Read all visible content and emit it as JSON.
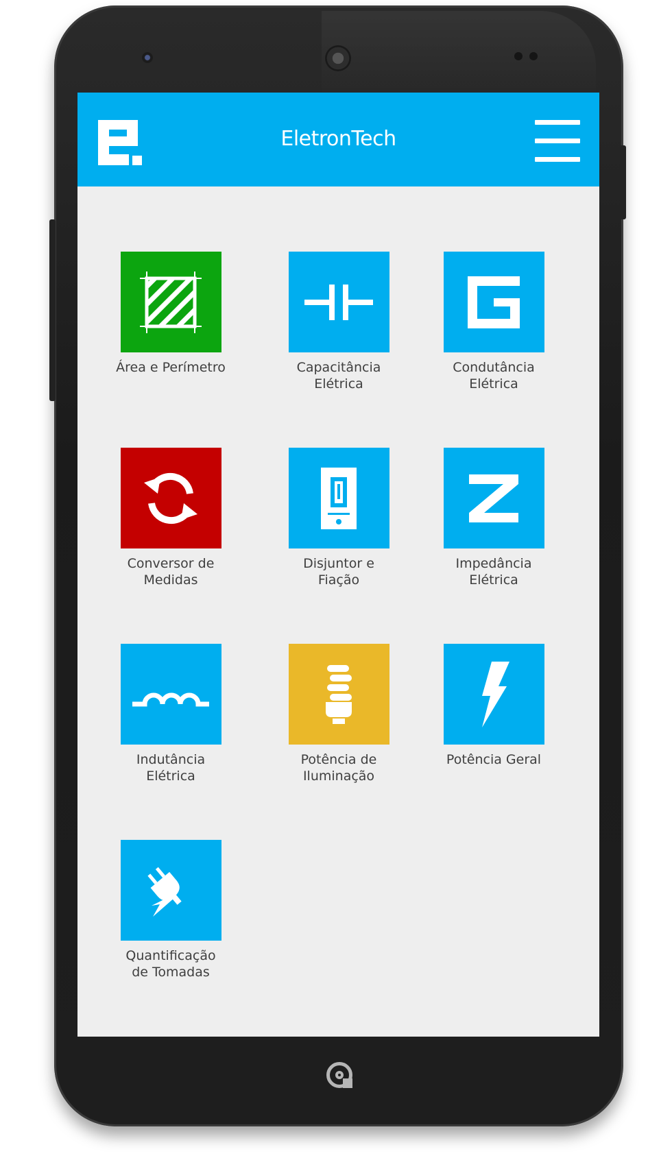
{
  "app": {
    "title": "EletronTech"
  },
  "colors": {
    "appbar": "#00aeef",
    "blue": "#00aeef",
    "green": "#0ca50f",
    "red": "#c40000",
    "yellow": "#eab829"
  },
  "tiles": [
    {
      "label": "Área e Perímetro",
      "icon": "area-hatch-icon",
      "color": "#0ca50f"
    },
    {
      "label": "Capacitância\nElétrica",
      "icon": "capacitor-icon",
      "color": "#00aeef"
    },
    {
      "label": "Condutância\nElétrica",
      "icon": "conductance-g-icon",
      "color": "#00aeef"
    },
    {
      "label": "Conversor de\nMedidas",
      "icon": "refresh-arrows-icon",
      "color": "#c40000"
    },
    {
      "label": "Disjuntor e\nFiação",
      "icon": "breaker-switch-icon",
      "color": "#00aeef"
    },
    {
      "label": "Impedância\nElétrica",
      "icon": "impedance-z-icon",
      "color": "#00aeef"
    },
    {
      "label": "Indutância\nElétrica",
      "icon": "inductor-coil-icon",
      "color": "#00aeef"
    },
    {
      "label": "Potência de\nIluminação",
      "icon": "light-bulb-icon",
      "color": "#eab829"
    },
    {
      "label": "Potência Geral",
      "icon": "lightning-bolt-icon",
      "color": "#00aeef"
    },
    {
      "label": "Quantificação\nde Tomadas",
      "icon": "power-plug-icon",
      "color": "#00aeef"
    }
  ]
}
